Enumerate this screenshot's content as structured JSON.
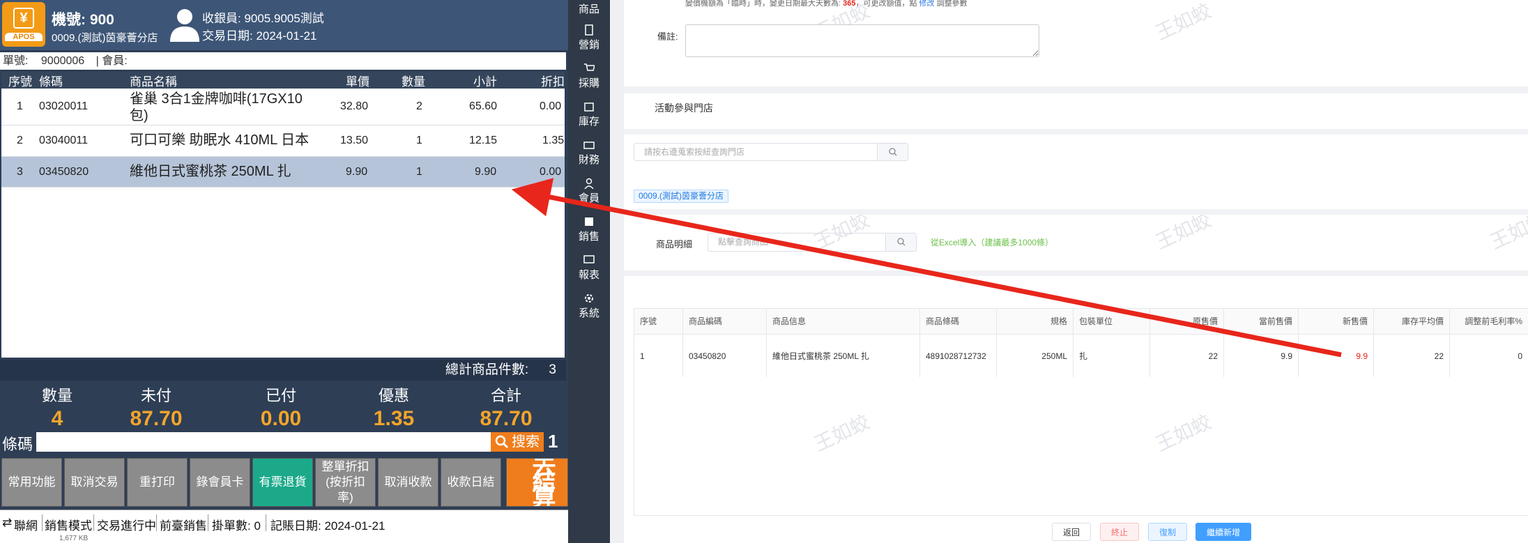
{
  "pos": {
    "logo_text": "APOS",
    "machine": "機號: 900",
    "store": "0009.(測試)茵豪薈分店",
    "cashier": "收銀員: 9005.9005測試",
    "trade_date": "交易日期: 2024-01-21",
    "order_label": "單號:",
    "order_no": "9000006",
    "member_label": "| 會員:",
    "columns": [
      "序號",
      "條碼",
      "商品名稱",
      "單價",
      "數量",
      "小計",
      "折扣"
    ],
    "rows": [
      {
        "no": "1",
        "code": "03020011",
        "name": "雀巢 3合1金牌咖啡(17GX10包)",
        "price": "32.80",
        "qty": "2",
        "subtotal": "65.60",
        "disc": "0.00"
      },
      {
        "no": "2",
        "code": "03040011",
        "name": "可口可樂 助眠水 410ML 日本",
        "price": "13.50",
        "qty": "1",
        "subtotal": "12.15",
        "disc": "1.35"
      },
      {
        "no": "3",
        "code": "03450820",
        "name": "維他日式蜜桃茶 250ML 扎",
        "price": "9.90",
        "qty": "1",
        "subtotal": "9.90",
        "disc": "0.00"
      }
    ],
    "total_items_label": "總計商品件數:",
    "total_items": "3",
    "totals": [
      {
        "label": "數量",
        "value": "4"
      },
      {
        "label": "未付",
        "value": "87.70"
      },
      {
        "label": "已付",
        "value": "0.00"
      },
      {
        "label": "優惠",
        "value": "1.35"
      },
      {
        "label": "合計",
        "value": "87.70"
      }
    ],
    "scan_label": "條碼",
    "search_label": "搜索",
    "scan_count": "1",
    "buttons": [
      "常用功能",
      "取消交易",
      "重打印",
      "錄會員卡",
      "有票退貨",
      "整單折扣(按折扣率)",
      "取消收款",
      "收款日結"
    ],
    "checkout": "去結算",
    "status": [
      "聯網",
      "銷售模式",
      "交易進行中",
      "前臺銷售",
      "掛單數: 0",
      "記賬日期: 2024-01-21"
    ],
    "mini": "1,677 KB"
  },
  "side": [
    "商品",
    "營銷",
    "採購",
    "庫存",
    "財務",
    "會員",
    "銷售",
    "報表",
    "系統"
  ],
  "erp": {
    "note_a": "變價機額為「臨時」時，變更日期最大天數為: ",
    "note_days": "365",
    "note_b": "，可更改額值，點 ",
    "note_link": "修改",
    "note_c": " 調整參數",
    "remark_label": "備註:",
    "store_section": "活動參與門店",
    "store_search_placeholder": "請按右邊蒐索按紐查詢門店",
    "store_tag": "0009.(測試)茵豪薈分店",
    "detail_section": "商品明細",
    "prod_search_placeholder": "點擊查詢商品",
    "excel_import": "從Excel導入（建議最多1000條）",
    "columns": [
      "序號",
      "商品編碼",
      "商品信息",
      "商品條碼",
      "規格",
      "包裝單位",
      "原售價",
      "當前售價",
      "新售價",
      "庫存平均價",
      "調整前毛利率%"
    ],
    "row": [
      "1",
      "03450820",
      "維他日式蜜桃茶 250ML 扎",
      "4891028712732",
      "250ML",
      "扎",
      "22",
      "9.9",
      "9.9",
      "22",
      "0"
    ],
    "actions": [
      "返回",
      "終止",
      "復制",
      "繼續新增"
    ],
    "watermark": "王如蛟"
  },
  "colors": {
    "arrow": "#e8261b",
    "accent_orange": "#f07d1c",
    "green_btn": "#1ba98a",
    "primary_blue": "#409eff"
  }
}
